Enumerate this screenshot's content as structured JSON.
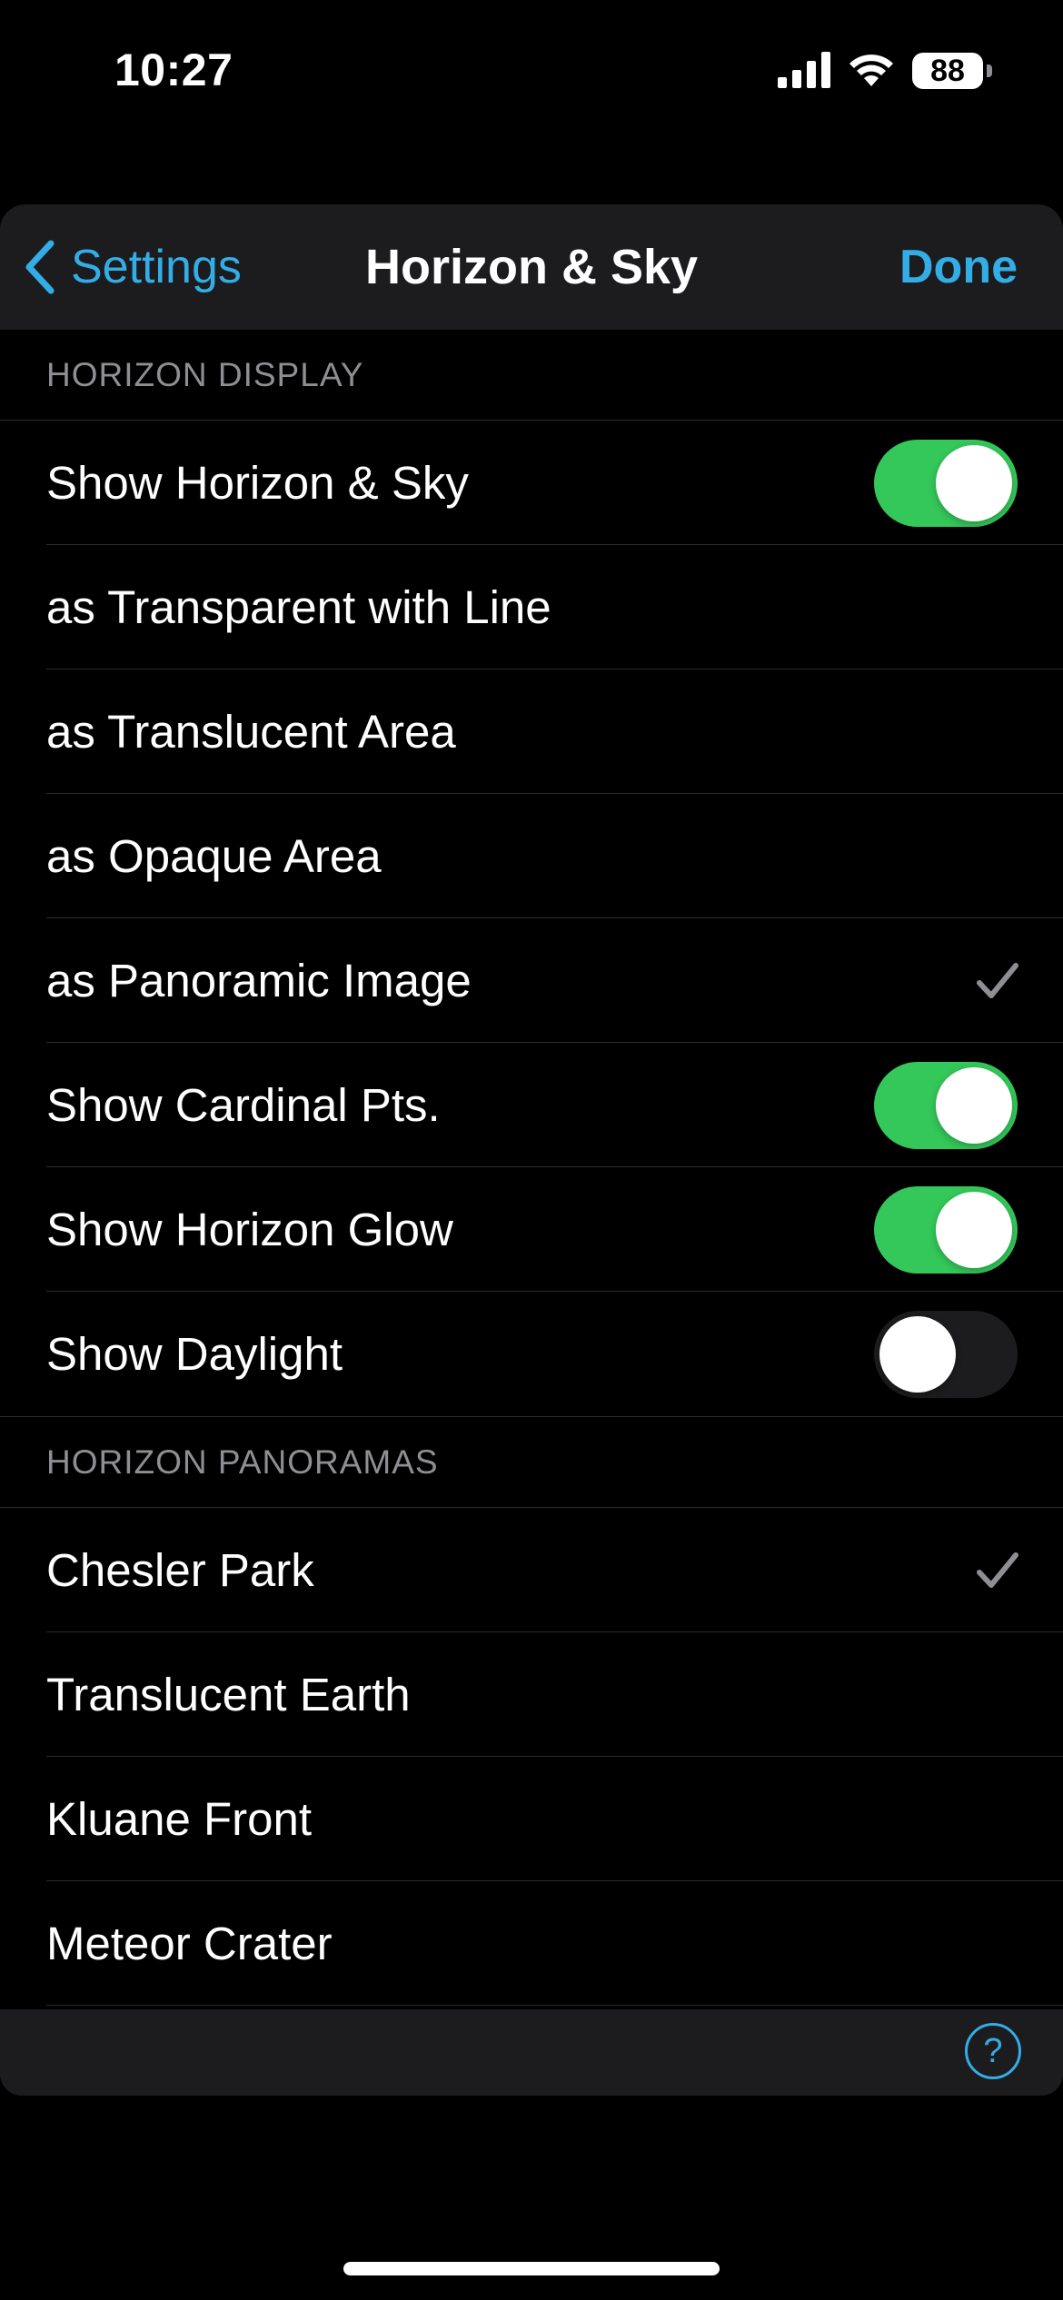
{
  "status_bar": {
    "time": "10:27",
    "battery": "88",
    "icons": [
      "signal-icon",
      "wifi-icon",
      "battery-icon"
    ]
  },
  "nav": {
    "back_label": "Settings",
    "title": "Horizon & Sky",
    "done_label": "Done"
  },
  "horizon_display": {
    "header": "HORIZON DISPLAY",
    "show_horizon": {
      "label": "Show Horizon & Sky",
      "on": true
    },
    "transparent_line": {
      "label": "as Transparent with Line"
    },
    "translucent_area": {
      "label": "as Translucent Area"
    },
    "opaque_area": {
      "label": "as Opaque Area"
    },
    "panoramic_image": {
      "label": "as Panoramic Image",
      "checked": true
    },
    "cardinal_pts": {
      "label": "Show Cardinal Pts.",
      "on": true
    },
    "horizon_glow": {
      "label": "Show Horizon Glow",
      "on": true
    },
    "daylight": {
      "label": "Show Daylight",
      "on": false
    }
  },
  "horizon_panoramas": {
    "header": "HORIZON PANORAMAS",
    "chesler_park": {
      "label": "Chesler Park",
      "checked": true
    },
    "translucent_earth": {
      "label": "Translucent Earth"
    },
    "kluane_front": {
      "label": "Kluane Front"
    },
    "meteor_crater": {
      "label": "Meteor Crater"
    }
  },
  "toolbar": {
    "help_label": "?"
  },
  "colors": {
    "accent": "#32ade6",
    "toggle_on": "#34c759",
    "background": "#000000",
    "bar_background": "#1c1c1e",
    "secondary_text": "#8e8e93"
  }
}
